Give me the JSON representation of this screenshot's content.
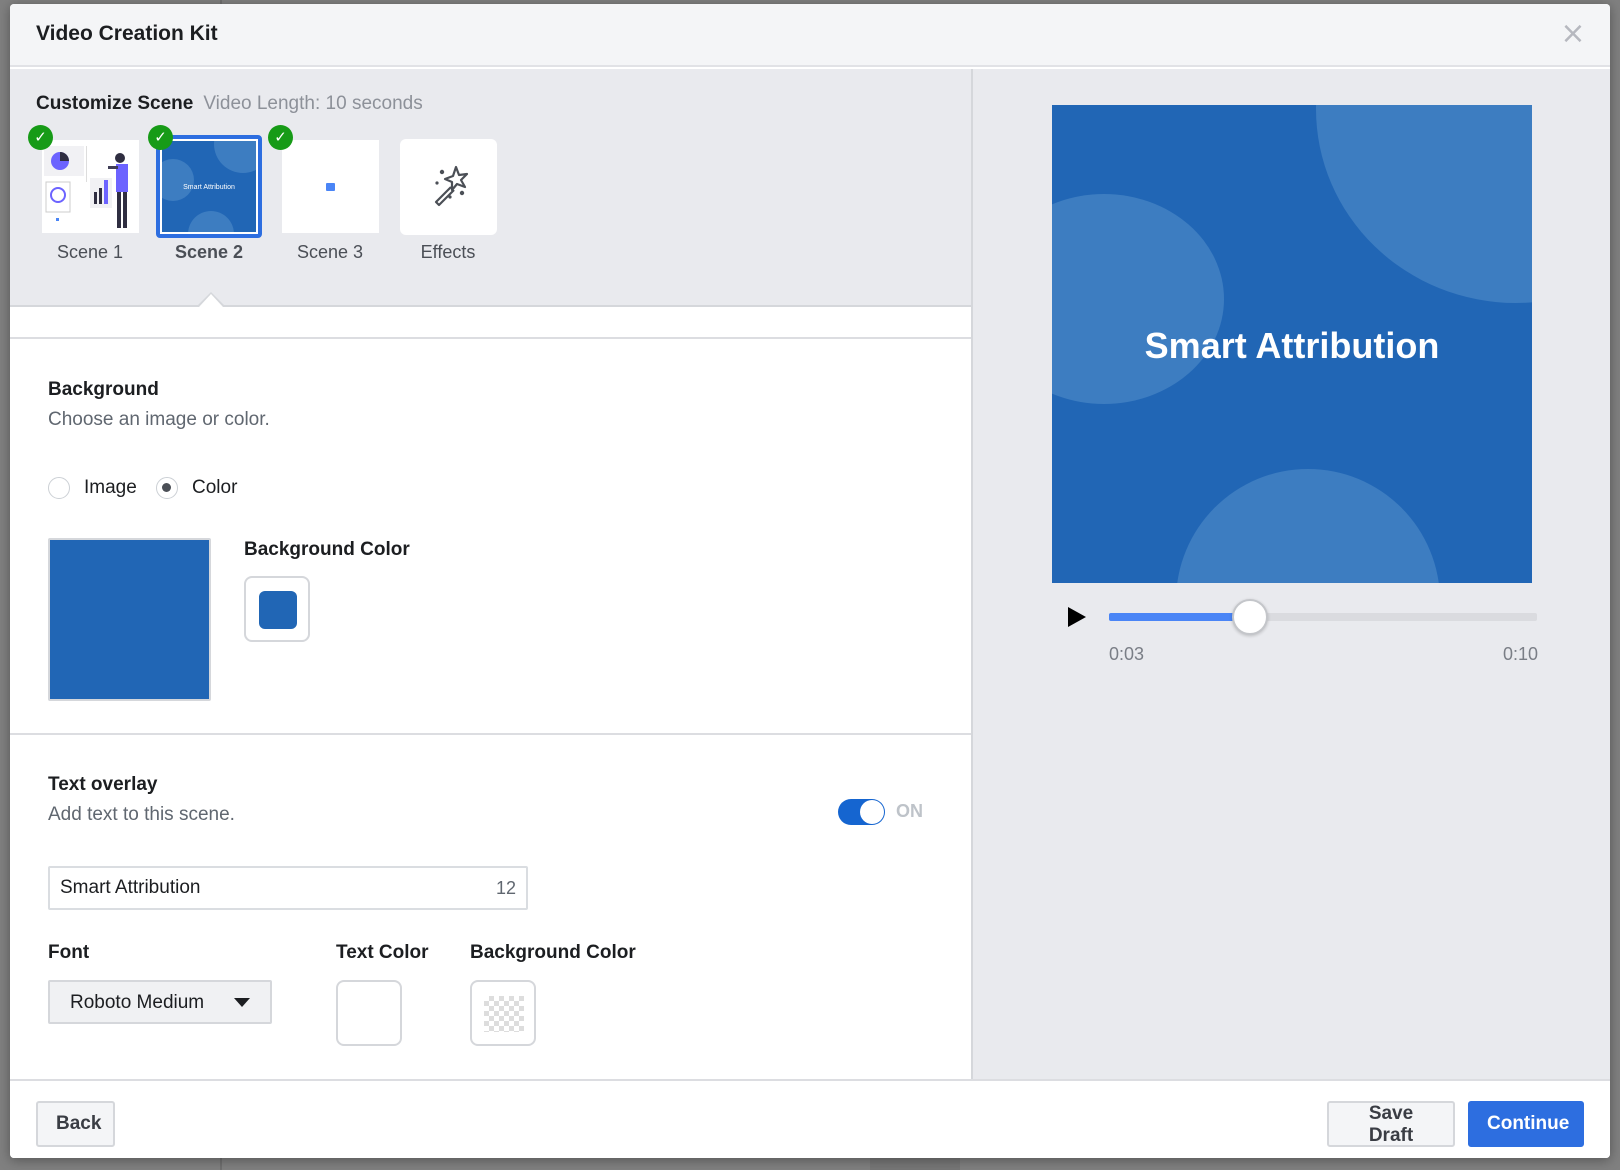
{
  "modal": {
    "title": "Video Creation Kit",
    "close_icon": "close-icon"
  },
  "customize": {
    "title": "Customize Scene",
    "video_length": "Video Length: 10 seconds",
    "scenes": [
      {
        "label": "Scene 1",
        "completed": true,
        "selected": false
      },
      {
        "label": "Scene 2",
        "completed": true,
        "selected": true,
        "thumb_text": "Smart Attribution"
      },
      {
        "label": "Scene 3",
        "completed": true,
        "selected": false
      },
      {
        "label": "Effects",
        "completed": false,
        "selected": false,
        "icon": "magic-wand-icon"
      }
    ]
  },
  "background": {
    "title": "Background",
    "subtitle": "Choose an image or color.",
    "options": [
      {
        "label": "Image",
        "checked": false
      },
      {
        "label": "Color",
        "checked": true
      }
    ],
    "color_label": "Background Color",
    "color": "#2166b5"
  },
  "text_overlay": {
    "title": "Text overlay",
    "subtitle": "Add text to this scene.",
    "toggle_state": "ON",
    "enabled": true,
    "text_value": "Smart Attribution",
    "char_count": "12",
    "font_label": "Font",
    "font_value": "Roboto Medium",
    "text_color_label": "Text Color",
    "text_color": "#ffffff",
    "bg_color_label": "Background Color",
    "bg_color": "transparent"
  },
  "preview": {
    "text": "Smart Attribution",
    "background": "#2166b5",
    "current_time": "0:03",
    "total_time": "0:10",
    "progress_fraction": 0.33
  },
  "footer": {
    "back_label": "Back",
    "save_draft_label": "Save Draft",
    "continue_label": "Continue"
  },
  "colors": {
    "accent": "#2d6ee0",
    "check_green": "#179b17",
    "toggle_on": "#1565d0",
    "progress": "#4a85f6"
  }
}
